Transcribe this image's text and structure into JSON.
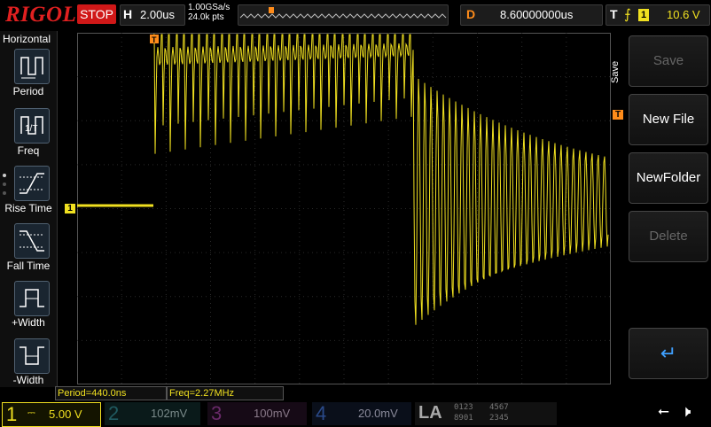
{
  "brand": "RIGOL",
  "run_state": "STOP",
  "horizontal": {
    "label": "H",
    "timebase": "2.00us",
    "sample_rate": "1.00GSa/s",
    "points": "24.0k pts"
  },
  "delay": {
    "label": "D",
    "value": "8.60000000us"
  },
  "trigger": {
    "label": "T",
    "channel": "1",
    "level": "10.6 V"
  },
  "left_menu": {
    "title": "Horizontal",
    "items": [
      {
        "label": "Period"
      },
      {
        "label": "Freq"
      },
      {
        "label": "Rise Time"
      },
      {
        "label": "Fall Time"
      },
      {
        "label": "+Width"
      },
      {
        "label": "-Width"
      }
    ]
  },
  "right_menu": {
    "title": "Save",
    "items": [
      {
        "label": "Save",
        "enabled": false
      },
      {
        "label": "New File",
        "enabled": true
      },
      {
        "label": "NewFolder",
        "enabled": true
      },
      {
        "label": "Delete",
        "enabled": false
      },
      {
        "label": "↵",
        "enabled": true
      }
    ]
  },
  "measurements": {
    "period": "Period=440.0ns",
    "freq": "Freq=2.27MHz"
  },
  "channels": [
    {
      "num": "1",
      "scale": "5.00 V",
      "color": "#f0e020"
    },
    {
      "num": "2",
      "scale": "102mV",
      "color": "#20b0c0"
    },
    {
      "num": "3",
      "scale": "100mV",
      "color": "#c030c0"
    },
    {
      "num": "4",
      "scale": "20.0mV",
      "color": "#2070e0"
    }
  ],
  "la": {
    "label": "LA",
    "groups": [
      "0123",
      "4567",
      "8901",
      "2345"
    ]
  },
  "markers": {
    "trigger_pos": "T",
    "ch1_marker": "1",
    "trigger_level_marker": "T"
  },
  "colors": {
    "ch1": "#f0e020",
    "delay": "#ff8c1a",
    "stop": "#d01818",
    "brand": "#e02020"
  }
}
